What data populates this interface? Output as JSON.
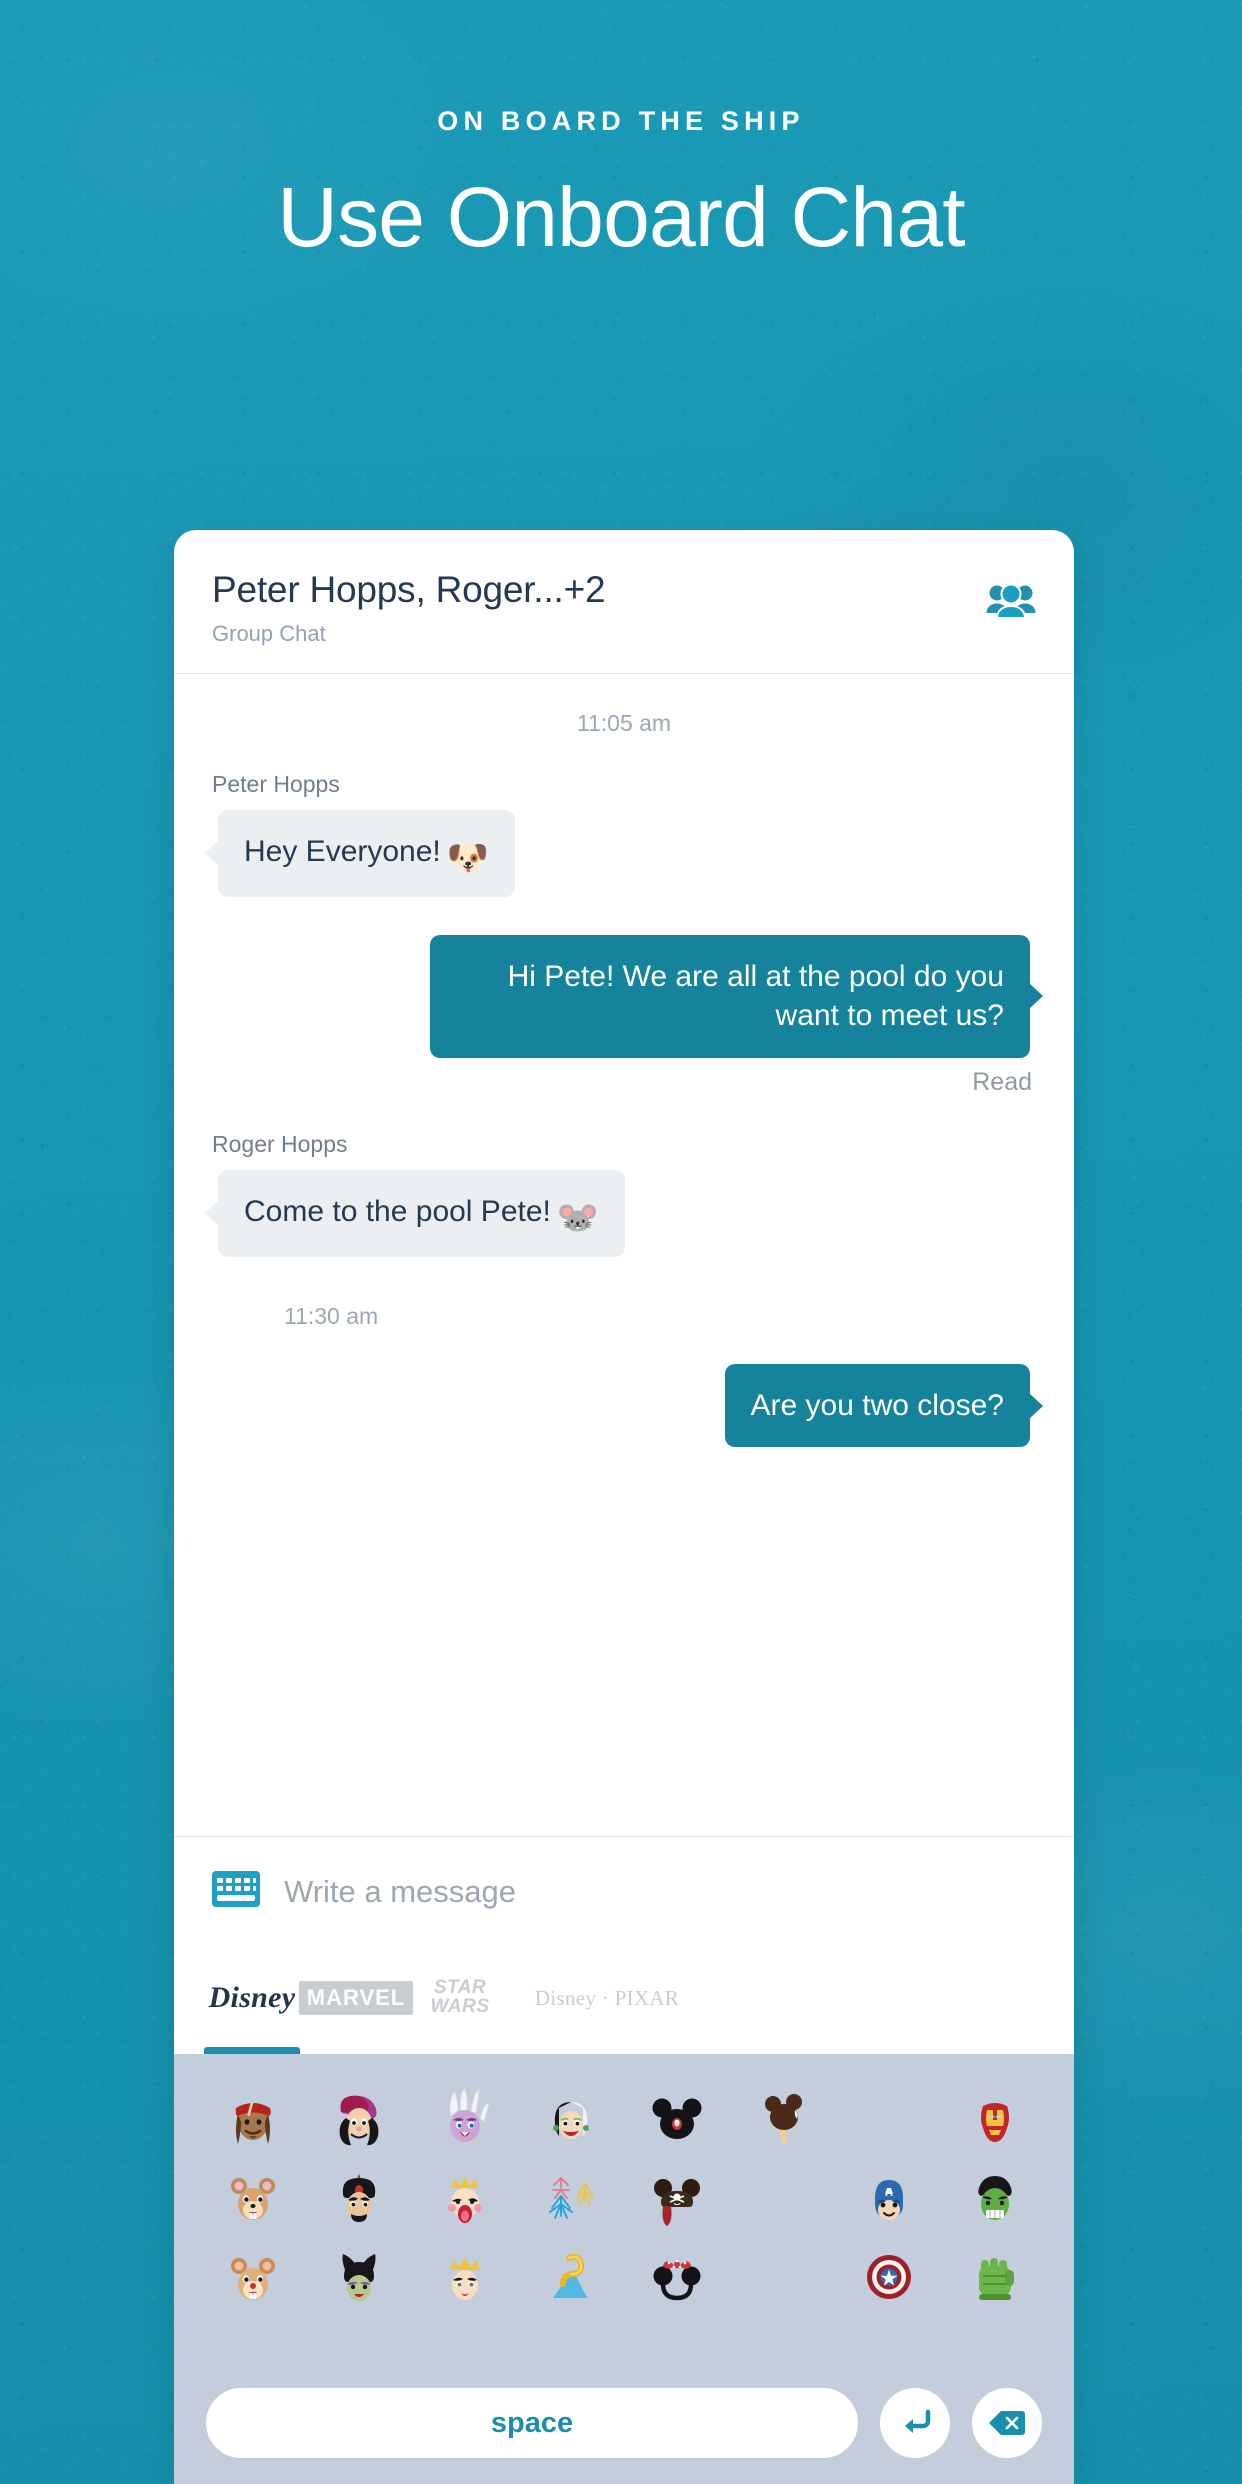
{
  "hero": {
    "eyebrow": "ON BOARD THE SHIP",
    "headline": "Use Onboard Chat"
  },
  "colors": {
    "background_teal": "#1896b4",
    "accent_teal": "#1a8fad",
    "outgoing_bubble": "#15839c",
    "incoming_bubble": "#eceff2",
    "title_navy": "#253a52",
    "muted_text": "#93a2b2",
    "keyboard_bg": "#c3cddb"
  },
  "chat": {
    "header": {
      "title": "Peter Hopps, Roger...+2",
      "subtitle": "Group Chat",
      "group_icon": "group-people-icon"
    },
    "thread": [
      {
        "kind": "timestamp",
        "text": "11:05 am",
        "align": "center"
      },
      {
        "kind": "sender",
        "text": "Peter Hopps"
      },
      {
        "kind": "message",
        "direction": "in",
        "text": "Hey Everyone!",
        "emoji": "🐶",
        "emoji_name": "goofy-emoji"
      },
      {
        "kind": "message",
        "direction": "out",
        "text": "Hi Pete! We are all at the pool do you want to meet us?"
      },
      {
        "kind": "status",
        "text": "Read"
      },
      {
        "kind": "sender",
        "text": "Roger Hopps"
      },
      {
        "kind": "message",
        "direction": "in",
        "text": "Come to the pool Pete!",
        "emoji": "🐭",
        "emoji_name": "mickey-emoji"
      },
      {
        "kind": "timestamp",
        "text": "11:30 am",
        "align": "left"
      },
      {
        "kind": "message",
        "direction": "out",
        "text": "Are you two close?"
      }
    ]
  },
  "composer": {
    "keyboard_icon": "keyboard-icon",
    "placeholder": "Write a message",
    "value": ""
  },
  "brand_tabs": [
    {
      "id": "disney",
      "label": "Disney",
      "active": true
    },
    {
      "id": "marvel",
      "label": "MARVEL",
      "active": false
    },
    {
      "id": "star-wars",
      "label": "STAR WARS",
      "active": false
    },
    {
      "id": "disney-pixar",
      "label": "Disney · PIXAR",
      "active": false
    }
  ],
  "emoji_keyboard": {
    "rows": [
      [
        {
          "name": "jack-sparrow-emoji",
          "glyph": "🏴‍☠️"
        },
        {
          "name": "captain-hook-emoji",
          "glyph": "🎩"
        },
        {
          "name": "ursula-emoji",
          "glyph": "🐙"
        },
        {
          "name": "cruella-emoji",
          "glyph": "💄"
        },
        {
          "name": "mickey-ears-hat-emoji",
          "glyph": "🎩"
        },
        {
          "name": "mickey-ice-cream-bar-emoji",
          "glyph": "🍫"
        },
        {
          "name": "blank",
          "glyph": ""
        },
        {
          "name": "iron-man-emoji",
          "glyph": "🤖"
        }
      ],
      [
        {
          "name": "chip-emoji",
          "glyph": "🐿️"
        },
        {
          "name": "jafar-emoji",
          "glyph": "🧙"
        },
        {
          "name": "queen-of-hearts-emoji",
          "glyph": "👑"
        },
        {
          "name": "fireworks-emoji",
          "glyph": "🎆"
        },
        {
          "name": "pirate-mickey-ears-emoji",
          "glyph": "☠️"
        },
        {
          "name": "blank",
          "glyph": ""
        },
        {
          "name": "captain-america-emoji",
          "glyph": "🦸"
        },
        {
          "name": "hulk-emoji",
          "glyph": "💚"
        }
      ],
      [
        {
          "name": "dale-emoji",
          "glyph": "🐿️"
        },
        {
          "name": "maleficent-emoji",
          "glyph": "😈"
        },
        {
          "name": "evil-queen-emoji",
          "glyph": "👸"
        },
        {
          "name": "aquaduck-slide-emoji",
          "glyph": "🌊"
        },
        {
          "name": "minnie-ears-emoji",
          "glyph": "🎀"
        },
        {
          "name": "blank",
          "glyph": ""
        },
        {
          "name": "captain-america-shield-emoji",
          "glyph": "🛡️"
        },
        {
          "name": "hulk-fist-emoji",
          "glyph": "✊"
        }
      ]
    ],
    "hawkeye_name": "hawkeye-emoji"
  },
  "keyboard_keys": {
    "space": "space",
    "enter_icon": "enter-return-icon",
    "delete_icon": "backspace-delete-icon"
  }
}
